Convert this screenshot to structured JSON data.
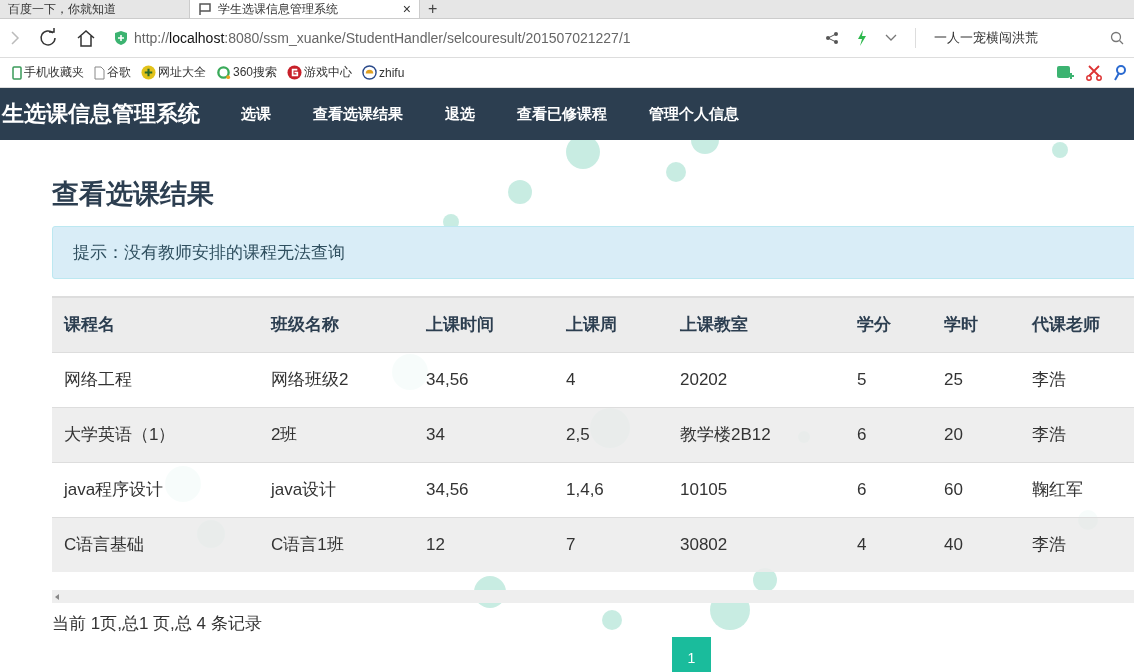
{
  "browser": {
    "tabs": [
      {
        "label": "百度一下，你就知道",
        "selected": false
      },
      {
        "label": "学生选课信息管理系统",
        "selected": true
      }
    ],
    "tab_close": "×",
    "new_tab": "+",
    "address": "http://**localhost**:8080/ssm_xuanke/StudentHandler/selcouresult/201507021227/1",
    "search": {
      "value": "一人一宠横闯洪荒"
    },
    "bookmarks": [
      "手机收藏夹",
      "谷歌",
      "网址大全",
      "360搜索",
      "游戏中心",
      "zhifu"
    ]
  },
  "navbar": {
    "brand": "生选课信息管理系统",
    "items": [
      "选课",
      "查看选课结果",
      "退选",
      "查看已修课程",
      "管理个人信息"
    ]
  },
  "page": {
    "heading": "查看选课结果",
    "alert": "提示：没有教师安排的课程无法查询"
  },
  "table": {
    "columns": [
      "课程名",
      "班级名称",
      "上课时间",
      "上课周",
      "上课教室",
      "学分",
      "学时",
      "代课老师"
    ],
    "rows": [
      [
        "网络工程",
        "网络班级2",
        "34,56",
        "4",
        "20202",
        "5",
        "25",
        "李浩"
      ],
      [
        "大学英语（1）",
        "2班",
        "34",
        "2,5",
        "教学楼2B12",
        "6",
        "20",
        "李浩"
      ],
      [
        "java程序设计",
        "java设计",
        "34,56",
        "1,4,6",
        "10105",
        "6",
        "60",
        "鞠红军"
      ],
      [
        "C语言基础",
        "C语言1班",
        "12",
        "7",
        "30802",
        "4",
        "40",
        "李浩"
      ]
    ]
  },
  "pagination": {
    "summary": "当前 1页,总1 页,总 4 条记录",
    "pages": [
      {
        "label": "1",
        "selected": true
      }
    ]
  }
}
